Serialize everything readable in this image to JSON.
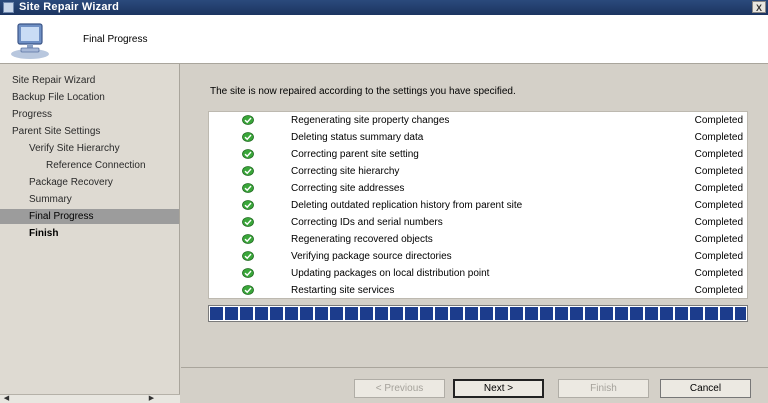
{
  "window": {
    "title": "Site Repair Wizard",
    "close_label": "X"
  },
  "header": {
    "page_title": "Final Progress"
  },
  "sidebar": {
    "items": [
      {
        "label": "Site Repair Wizard"
      },
      {
        "label": "Backup File Location"
      },
      {
        "label": "Progress"
      },
      {
        "label": "Parent Site Settings"
      },
      {
        "label": "Verify Site Hierarchy"
      },
      {
        "label": "Reference Connection"
      },
      {
        "label": "Package Recovery"
      },
      {
        "label": "Summary"
      },
      {
        "label": "Final Progress"
      },
      {
        "label": "Finish"
      }
    ]
  },
  "main": {
    "intro": "The site is now repaired according to the settings you have specified.",
    "tasks": [
      {
        "name": "Regenerating site property changes",
        "status": "Completed"
      },
      {
        "name": "Deleting status summary data",
        "status": "Completed"
      },
      {
        "name": "Correcting parent site setting",
        "status": "Completed"
      },
      {
        "name": "Correcting site hierarchy",
        "status": "Completed"
      },
      {
        "name": "Correcting site addresses",
        "status": "Completed"
      },
      {
        "name": "Deleting outdated replication history from parent site",
        "status": "Completed"
      },
      {
        "name": "Correcting IDs and serial numbers",
        "status": "Completed"
      },
      {
        "name": "Regenerating recovered objects",
        "status": "Completed"
      },
      {
        "name": "Verifying package source directories",
        "status": "Completed"
      },
      {
        "name": "Updating packages on local distribution point",
        "status": "Completed"
      },
      {
        "name": "Restarting site services",
        "status": "Completed"
      }
    ],
    "progress_percent": 100
  },
  "footer": {
    "previous_label": "< Previous",
    "next_label": "Next >",
    "finish_label": "Finish",
    "cancel_label": "Cancel"
  },
  "colors": {
    "titlebar": "#1c3460",
    "progress_fill": "#1c3c8c",
    "selected_nav": "#9c9c9c",
    "ok_icon": "#3aa63a"
  }
}
